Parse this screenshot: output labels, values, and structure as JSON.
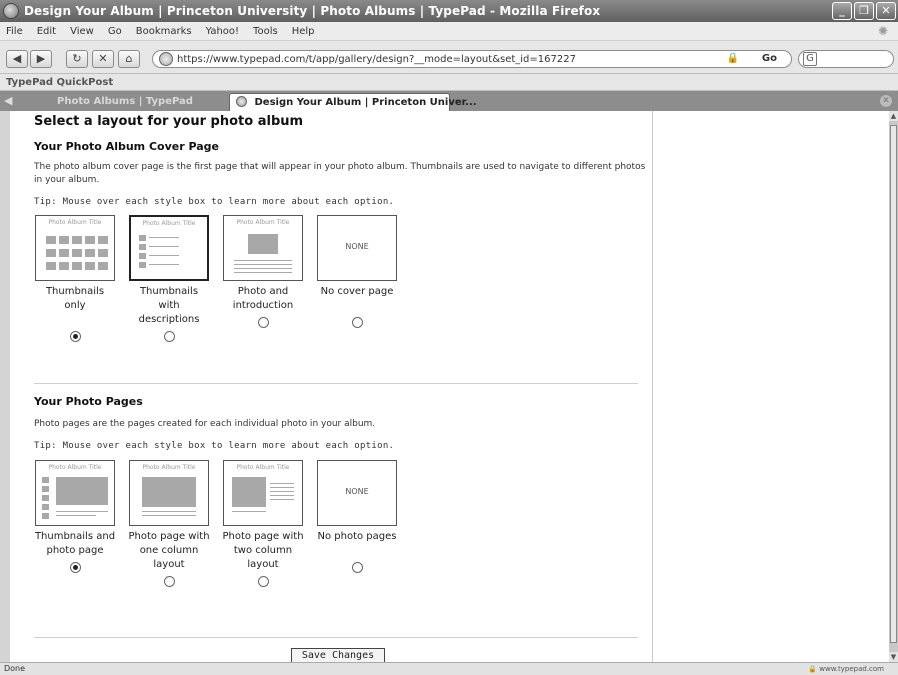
{
  "window": {
    "title": "Design Your Album | Princeton University | Photo Albums | TypePad - Mozilla Firefox",
    "controls": [
      "_",
      "❐",
      "✕"
    ]
  },
  "menu": [
    "File",
    "Edit",
    "View",
    "Go",
    "Bookmarks",
    "Yahoo!",
    "Tools",
    "Help"
  ],
  "nav": {
    "url": "https://www.typepad.com/t/app/gallery/design?__mode=layout&set_id=167227",
    "go_label": "Go",
    "search_engine_icon": "google-icon"
  },
  "bookmarks": {
    "item": "TypePad QuickPost"
  },
  "tabs": [
    {
      "label": "Photo Albums | TypePad",
      "active": false
    },
    {
      "label": "Design Your Album | Princeton Univer...",
      "active": true
    }
  ],
  "page": {
    "title": "Select a layout for your photo album",
    "cover": {
      "heading": "Your Photo Album Cover Page",
      "description": "The photo album cover page is the first page that will appear in your photo album. Thumbnails are used to navigate to different photos in your album.",
      "tip": "Tip: Mouse over each style box to learn more about each option.",
      "options": [
        {
          "label": "Thumbnails only",
          "thumb_title": "Photo Album Title",
          "selected": true
        },
        {
          "label": "Thumbnails with descriptions",
          "thumb_title": "Photo Album Title",
          "selected": false
        },
        {
          "label": "Photo and introduction",
          "thumb_title": "Photo Album Title",
          "selected": false
        },
        {
          "label": "No cover page",
          "thumb_title": "NONE",
          "selected": false
        }
      ]
    },
    "photo_pages": {
      "heading": "Your Photo Pages",
      "description": "Photo pages are the pages created for each individual photo in your album.",
      "tip": "Tip: Mouse over each style box to learn more about each option.",
      "options": [
        {
          "label": "Thumbnails and photo page",
          "thumb_title": "Photo Album Title",
          "selected": true
        },
        {
          "label": "Photo page with one column layout",
          "thumb_title": "Photo Album Title",
          "selected": false
        },
        {
          "label": "Photo page with two column layout",
          "thumb_title": "Photo Album Title",
          "selected": false
        },
        {
          "label": "No photo pages",
          "thumb_title": "NONE",
          "selected": false
        }
      ]
    },
    "save_label": "Save Changes"
  },
  "status": {
    "left": "Done",
    "right": "www.typepad.com"
  }
}
